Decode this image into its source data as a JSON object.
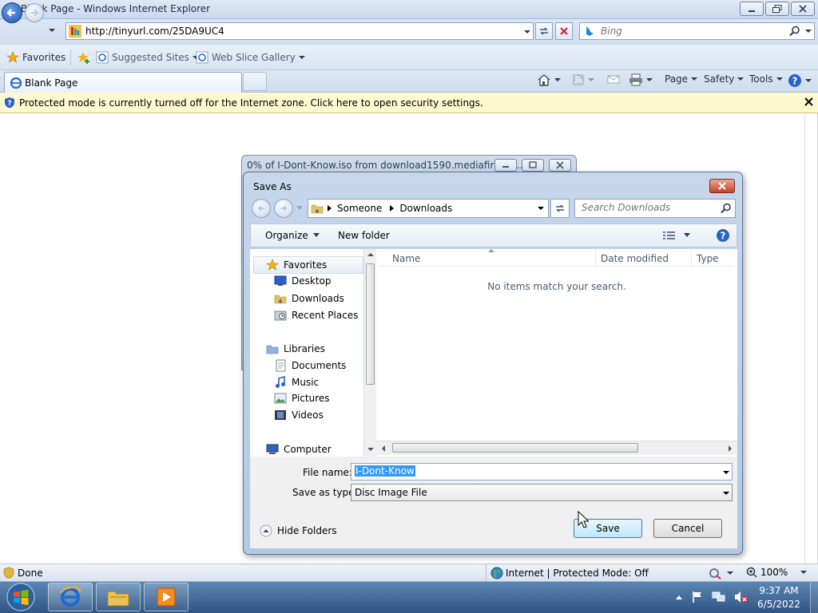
{
  "window": {
    "title": "Blank Page - Windows Internet Explorer"
  },
  "address": {
    "url": "http://tinyurl.com/25DA9UC4"
  },
  "search": {
    "placeholder": "Bing"
  },
  "favorites_bar": {
    "favorites_label": "Favorites",
    "suggested_sites": "Suggested Sites",
    "web_slice_gallery": "Web Slice Gallery"
  },
  "tab": {
    "title": "Blank Page"
  },
  "command_bar": {
    "page": "Page",
    "safety": "Safety",
    "tools": "Tools"
  },
  "info_bar": {
    "message": "Protected mode is currently turned off for the Internet zone.  Click here to open security settings."
  },
  "progress_window": {
    "title": "0% of I-Dont-Know.iso from download1590.mediafire.co..."
  },
  "save_dialog": {
    "title": "Save As",
    "breadcrumb": [
      "Someone",
      "Downloads"
    ],
    "search_placeholder": "Search Downloads",
    "organize": "Organize",
    "new_folder": "New folder",
    "nav": {
      "favorites": "Favorites",
      "desktop": "Desktop",
      "downloads": "Downloads",
      "recent_places": "Recent Places",
      "libraries": "Libraries",
      "documents": "Documents",
      "music": "Music",
      "pictures": "Pictures",
      "videos": "Videos",
      "computer": "Computer"
    },
    "columns": {
      "name": "Name",
      "date_modified": "Date modified",
      "type": "Type"
    },
    "empty_message": "No items match your search.",
    "file_name_label": "File name:",
    "file_name_value": "I-Dont-Know",
    "save_type_label": "Save as type:",
    "save_type_value": "Disc Image File",
    "hide_folders": "Hide Folders",
    "save": "Save",
    "cancel": "Cancel"
  },
  "status_bar": {
    "left": "Done",
    "zone": "Internet | Protected Mode: Off",
    "zoom": "100%"
  },
  "taskbar": {
    "time": "9:37 AM",
    "date": "6/5/2022"
  },
  "colors": {
    "accent": "#1f56b8",
    "info_bar": "#fdf9cf",
    "selection": "#3399ff"
  }
}
